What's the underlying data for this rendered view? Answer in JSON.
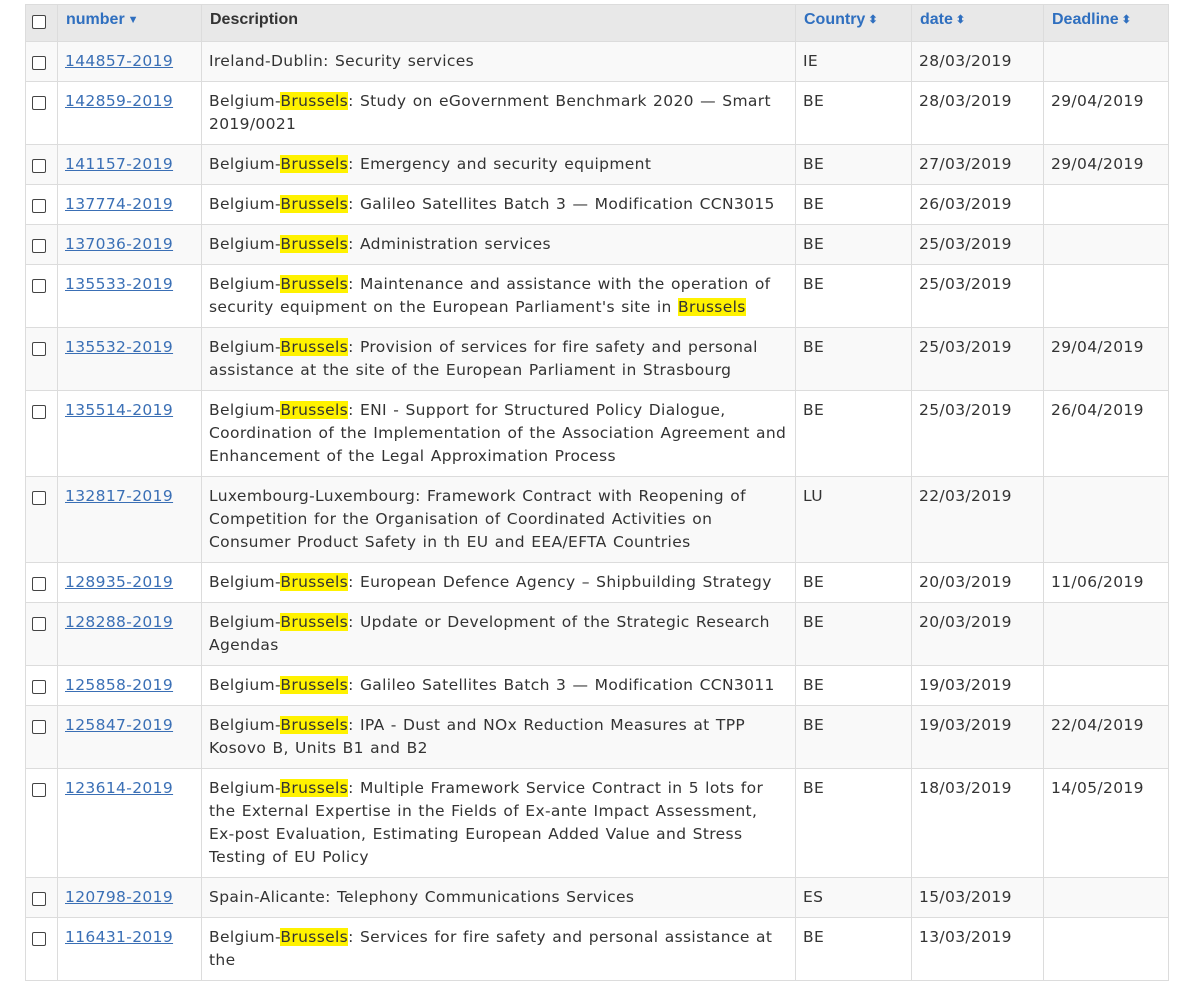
{
  "columns": {
    "number": "number",
    "description": "Description",
    "country": "Country",
    "date": "date",
    "deadline": "Deadline"
  },
  "highlight_term": "Brussels",
  "colors": {
    "link": "#3a6fb5",
    "highlight": "#fff200",
    "header_bg": "#e8e8e8"
  },
  "rows": [
    {
      "number": "144857-2019",
      "description": "Ireland-Dublin: Security services",
      "country": "IE",
      "date": "28/03/2019",
      "deadline": ""
    },
    {
      "number": "142859-2019",
      "description": "Belgium-Brussels: Study on eGovernment Benchmark 2020 — Smart 2019/0021",
      "country": "BE",
      "date": "28/03/2019",
      "deadline": "29/04/2019"
    },
    {
      "number": "141157-2019",
      "description": "Belgium-Brussels: Emergency and security equipment",
      "country": "BE",
      "date": "27/03/2019",
      "deadline": "29/04/2019"
    },
    {
      "number": "137774-2019",
      "description": "Belgium-Brussels: Galileo Satellites Batch 3 — Modification CCN3015",
      "country": "BE",
      "date": "26/03/2019",
      "deadline": ""
    },
    {
      "number": "137036-2019",
      "description": "Belgium-Brussels: Administration services",
      "country": "BE",
      "date": "25/03/2019",
      "deadline": ""
    },
    {
      "number": "135533-2019",
      "description": "Belgium-Brussels: Maintenance and assistance with the operation of security equipment on the European Parliament's site in Brussels",
      "country": "BE",
      "date": "25/03/2019",
      "deadline": ""
    },
    {
      "number": "135532-2019",
      "description": "Belgium-Brussels: Provision of services for fire safety and personal assistance at the site of the European Parliament in Strasbourg",
      "country": "BE",
      "date": "25/03/2019",
      "deadline": "29/04/2019"
    },
    {
      "number": "135514-2019",
      "description": "Belgium-Brussels: ENI - Support for Structured Policy Dialogue, Coordination of the Implementation of the Association Agreement and Enhancement of the Legal Approximation Process",
      "country": "BE",
      "date": "25/03/2019",
      "deadline": "26/04/2019"
    },
    {
      "number": "132817-2019",
      "description": "Luxembourg-Luxembourg: Framework Contract with Reopening of Competition for the Organisation of Coordinated Activities on Consumer Product Safety in th EU and EEA/EFTA Countries",
      "country": "LU",
      "date": "22/03/2019",
      "deadline": ""
    },
    {
      "number": "128935-2019",
      "description": "Belgium-Brussels: European Defence Agency – Shipbuilding Strategy",
      "country": "BE",
      "date": "20/03/2019",
      "deadline": "11/06/2019"
    },
    {
      "number": "128288-2019",
      "description": "Belgium-Brussels: Update or Development of the Strategic Research Agendas",
      "country": "BE",
      "date": "20/03/2019",
      "deadline": ""
    },
    {
      "number": "125858-2019",
      "description": "Belgium-Brussels: Galileo Satellites Batch 3 — Modification CCN3011",
      "country": "BE",
      "date": "19/03/2019",
      "deadline": ""
    },
    {
      "number": "125847-2019",
      "description": "Belgium-Brussels: IPA - Dust and NOx Reduction Measures at TPP Kosovo B, Units B1 and B2",
      "country": "BE",
      "date": "19/03/2019",
      "deadline": "22/04/2019"
    },
    {
      "number": "123614-2019",
      "description": "Belgium-Brussels: Multiple Framework Service Contract in 5 lots for the External Expertise in the Fields of Ex-ante Impact Assessment, Ex-post Evaluation, Estimating European Added Value and Stress Testing of EU Policy",
      "country": "BE",
      "date": "18/03/2019",
      "deadline": "14/05/2019"
    },
    {
      "number": "120798-2019",
      "description": "Spain-Alicante: Telephony Communications Services",
      "country": "ES",
      "date": "15/03/2019",
      "deadline": ""
    },
    {
      "number": "116431-2019",
      "description": "Belgium-Brussels: Services for fire safety and personal assistance at the",
      "country": "BE",
      "date": "13/03/2019",
      "deadline": ""
    }
  ]
}
